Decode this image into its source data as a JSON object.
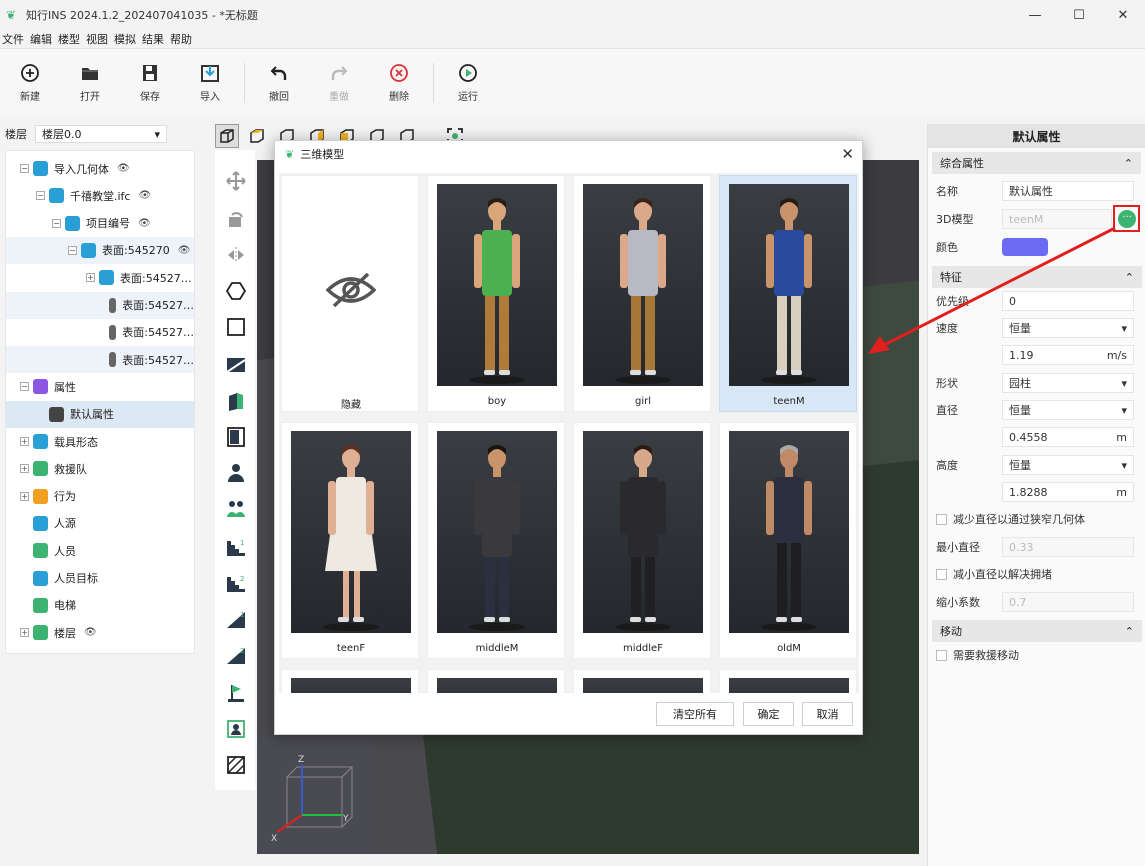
{
  "window": {
    "title": "知行INS 2024.1.2_202407041035 - *无标题",
    "minimize": "—",
    "maximize": "☐",
    "close": "✕"
  },
  "menu": [
    "文件",
    "编辑",
    "楼型",
    "视图",
    "模拟",
    "结果",
    "帮助"
  ],
  "toolbar": [
    {
      "label": "新建",
      "icon": "plus-circle-icon",
      "enabled": true
    },
    {
      "label": "打开",
      "icon": "folder-icon",
      "enabled": true
    },
    {
      "label": "保存",
      "icon": "save-icon",
      "enabled": true
    },
    {
      "label": "导入",
      "icon": "import-icon",
      "enabled": true
    },
    {
      "label": "撤回",
      "icon": "undo-icon",
      "enabled": true
    },
    {
      "label": "重做",
      "icon": "redo-icon",
      "enabled": false
    },
    {
      "label": "删除",
      "icon": "delete-icon",
      "enabled": true
    },
    {
      "label": "运行",
      "icon": "play-icon",
      "enabled": true
    }
  ],
  "floor": {
    "label": "楼层",
    "value": "楼层0.0"
  },
  "tree": [
    {
      "label": "导入几何体",
      "indent": 0,
      "expander": "−",
      "color": "#2a9fd6",
      "eye": true
    },
    {
      "label": "千禧教堂.ifc",
      "indent": 1,
      "expander": "−",
      "color": "#2a9fd6",
      "eye": true
    },
    {
      "label": "项目编号",
      "indent": 2,
      "expander": "−",
      "color": "#2a9fd6",
      "eye": true
    },
    {
      "label": "表面:545270",
      "indent": 3,
      "expander": "−",
      "color": "#2a9fd6",
      "eye": true
    },
    {
      "label": "表面:54527…",
      "indent": 4,
      "expander": "+",
      "color": "#2a9fd6",
      "eye": false
    },
    {
      "label": "表面:54527…",
      "indent": 5,
      "expander": "",
      "color": "#666",
      "eye": false
    },
    {
      "label": "表面:54527…",
      "indent": 5,
      "expander": "",
      "color": "#666",
      "eye": false
    },
    {
      "label": "表面:54527…",
      "indent": 5,
      "expander": "",
      "color": "#666",
      "eye": false
    },
    {
      "label": "属性",
      "indent": 0,
      "expander": "−",
      "color": "#8a56e2",
      "eye": false
    },
    {
      "label": "默认属性",
      "indent": 1,
      "expander": "",
      "color": "#444",
      "eye": false
    },
    {
      "label": "载具形态",
      "indent": 0,
      "expander": "+",
      "color": "#2a9fd6",
      "eye": false
    },
    {
      "label": "救援队",
      "indent": 0,
      "expander": "+",
      "color": "#3cb371",
      "eye": false
    },
    {
      "label": "行为",
      "indent": 0,
      "expander": "+",
      "color": "#f0a020",
      "eye": false
    },
    {
      "label": "人源",
      "indent": 0,
      "expander": "",
      "color": "#2a9fd6",
      "eye": false
    },
    {
      "label": "人员",
      "indent": 0,
      "expander": "",
      "color": "#3cb371",
      "eye": false
    },
    {
      "label": "人员目标",
      "indent": 0,
      "expander": "",
      "color": "#2a9fd6",
      "eye": false
    },
    {
      "label": "电梯",
      "indent": 0,
      "expander": "",
      "color": "#3cb371",
      "eye": false
    },
    {
      "label": "楼层",
      "indent": 0,
      "expander": "+",
      "color": "#3cb371",
      "eye": true
    }
  ],
  "properties": {
    "title": "默认属性",
    "section_general": "综合属性",
    "name_label": "名称",
    "name_value": "默认属性",
    "model_label": "3D模型",
    "model_value": "teenM",
    "color_label": "颜色",
    "color_value": "#6b6bf5",
    "section_feature": "特征",
    "priority_label": "优先级",
    "priority_value": "0",
    "speed_label": "速度",
    "speed_mode": "恒量",
    "speed_value": "1.19",
    "speed_unit": "m/s",
    "shape_label": "形状",
    "shape_value": "园柱",
    "diameter_label": "直径",
    "diameter_mode": "恒量",
    "diameter_value": "0.4558",
    "diameter_unit": "m",
    "height_label": "高度",
    "height_mode": "恒量",
    "height_value": "1.8288",
    "height_unit": "m",
    "reduce_narrow": "减少直径以通过狭窄几何体",
    "min_diameter_label": "最小直径",
    "min_diameter_value": "0.33",
    "reduce_crowd": "减小直径以解决拥堵",
    "shrink_label": "缩小系数",
    "shrink_value": "0.7",
    "section_move": "移动",
    "need_rescue": "需要救援移动"
  },
  "modal": {
    "title": "三维模型",
    "models": [
      {
        "name": "隐藏",
        "kind": "hidden"
      },
      {
        "name": "boy",
        "shirt": "#4caf50",
        "pants": "#b07a3a",
        "skin": "#d9a57a",
        "hair": "#2a1c14"
      },
      {
        "name": "girl",
        "shirt": "#b9b9c4",
        "pants": "#a87838",
        "skin": "#dba98a",
        "hair": "#3a2418"
      },
      {
        "name": "teenM",
        "shirt": "#2a4aa0",
        "pants": "#d8d0bc",
        "skin": "#c9946c",
        "hair": "#2a1c14"
      },
      {
        "name": "teenF",
        "shirt": "#eeeae2",
        "pants": "#eeeae2",
        "skin": "#e0b095",
        "hair": "#5a3020"
      },
      {
        "name": "middleM",
        "shirt": "#3a3a3e",
        "pants": "#2a3040",
        "skin": "#c9946c",
        "hair": "#1a1410"
      },
      {
        "name": "middleF",
        "shirt": "#2a2a2e",
        "pants": "#202024",
        "skin": "#d8a88a",
        "hair": "#2a1c14"
      },
      {
        "name": "oldM",
        "shirt": "#2a3040",
        "pants": "#1e1e22",
        "skin": "#c08a66",
        "hair": "#a8a8a8"
      }
    ],
    "buttons": {
      "clear": "清空所有",
      "ok": "确定",
      "cancel": "取消"
    }
  },
  "viewport": {
    "axis_z": "Z",
    "axis_x": "X",
    "axis_y": "Y"
  }
}
